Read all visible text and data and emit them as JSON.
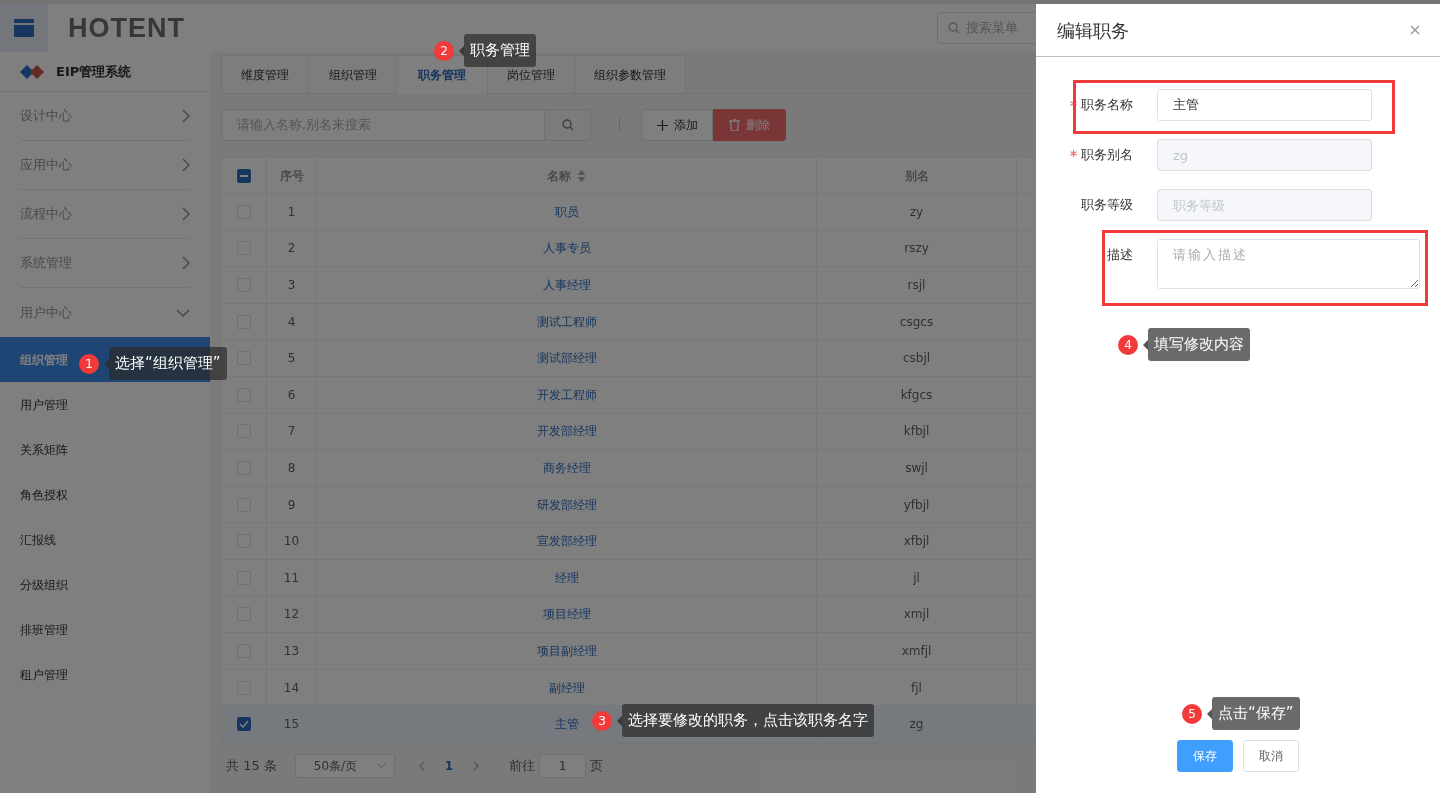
{
  "header": {
    "logo": "HOTENT",
    "search_placeholder": "搜索菜单"
  },
  "sidebar": {
    "title": "EIP管理系统",
    "items": [
      {
        "label": "设计中心",
        "expanded": false
      },
      {
        "label": "应用中心",
        "expanded": false
      },
      {
        "label": "流程中心",
        "expanded": false
      },
      {
        "label": "系统管理",
        "expanded": false
      },
      {
        "label": "用户中心",
        "expanded": true,
        "children": [
          {
            "label": "组织管理",
            "selected": true
          },
          {
            "label": "用户管理",
            "selected": false
          },
          {
            "label": "关系矩阵",
            "selected": false
          },
          {
            "label": "角色授权",
            "selected": false
          },
          {
            "label": "汇报线",
            "selected": false
          },
          {
            "label": "分级组织",
            "selected": false
          },
          {
            "label": "排班管理",
            "selected": false
          },
          {
            "label": "租户管理",
            "selected": false
          }
        ]
      }
    ]
  },
  "tabs": [
    {
      "label": "维度管理",
      "selected": false
    },
    {
      "label": "组织管理",
      "selected": false
    },
    {
      "label": "职务管理",
      "selected": true
    },
    {
      "label": "岗位管理",
      "selected": false
    },
    {
      "label": "组织参数管理",
      "selected": false
    }
  ],
  "search": {
    "placeholder": "请输入名称,别名来搜索"
  },
  "toolbar": {
    "add": "添加",
    "delete": "删除"
  },
  "table": {
    "columns": [
      "序号",
      "名称",
      "别名"
    ],
    "header_indeterminate": true,
    "rows": [
      {
        "index": "1",
        "name": "职员",
        "alias": "zy",
        "checked": false
      },
      {
        "index": "2",
        "name": "人事专员",
        "alias": "rszy",
        "checked": false
      },
      {
        "index": "3",
        "name": "人事经理",
        "alias": "rsjl",
        "checked": false
      },
      {
        "index": "4",
        "name": "测试工程师",
        "alias": "csgcs",
        "checked": false
      },
      {
        "index": "5",
        "name": "测试部经理",
        "alias": "csbjl",
        "checked": false
      },
      {
        "index": "6",
        "name": "开发工程师",
        "alias": "kfgcs",
        "checked": false
      },
      {
        "index": "7",
        "name": "开发部经理",
        "alias": "kfbjl",
        "checked": false
      },
      {
        "index": "8",
        "name": "商务经理",
        "alias": "swjl",
        "checked": false
      },
      {
        "index": "9",
        "name": "研发部经理",
        "alias": "yfbjl",
        "checked": false
      },
      {
        "index": "10",
        "name": "宣发部经理",
        "alias": "xfbjl",
        "checked": false
      },
      {
        "index": "11",
        "name": "经理",
        "alias": "jl",
        "checked": false
      },
      {
        "index": "12",
        "name": "项目经理",
        "alias": "xmjl",
        "checked": false
      },
      {
        "index": "13",
        "name": "项目副经理",
        "alias": "xmfjl",
        "checked": false
      },
      {
        "index": "14",
        "name": "副经理",
        "alias": "fjl",
        "checked": false
      },
      {
        "index": "15",
        "name": "主管",
        "alias": "zg",
        "checked": true
      }
    ]
  },
  "pagination": {
    "total": "共 15 条",
    "page_size": "50条/页",
    "pages": [
      {
        "label": "1",
        "selected": true
      }
    ],
    "goto_label": "前往",
    "goto_value": "1",
    "goto_suffix": "页"
  },
  "drawer": {
    "title": "编辑职务",
    "fields": [
      {
        "label": "职务名称",
        "required": true,
        "kind": "input",
        "value": "主管",
        "disabled": false,
        "highlighted": true
      },
      {
        "label": "职务别名",
        "required": true,
        "kind": "input",
        "value": "zg",
        "disabled": true,
        "highlighted": false
      },
      {
        "label": "职务等级",
        "required": false,
        "kind": "input",
        "placeholder": "职务等级",
        "disabled": true,
        "highlighted": false
      },
      {
        "label": "描述",
        "required": false,
        "kind": "textarea",
        "placeholder": "请输入描述",
        "disabled": false,
        "highlighted": true
      }
    ],
    "buttons": [
      {
        "label": "保存",
        "kind": "primary"
      },
      {
        "label": "取消",
        "kind": "default"
      }
    ]
  },
  "callouts": [
    {
      "number": "1",
      "text": "选择“组织管理”"
    },
    {
      "number": "2",
      "text": "职务管理"
    },
    {
      "number": "3",
      "text": "选择要修改的职务，点击该职务名字"
    },
    {
      "number": "4",
      "text": "填写修改内容"
    },
    {
      "number": "5",
      "text": "点击“保存”"
    }
  ]
}
